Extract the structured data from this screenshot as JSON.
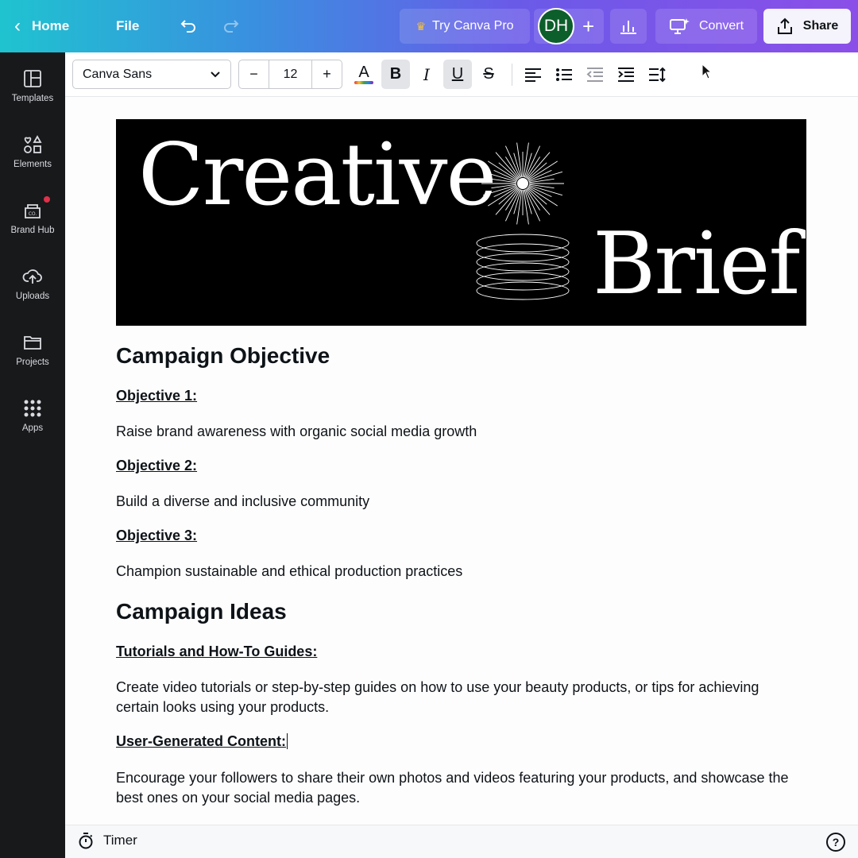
{
  "topbar": {
    "home_label": "Home",
    "file_label": "File",
    "try_pro_label": "Try Canva Pro",
    "avatar_initials": "DH",
    "convert_label": "Convert",
    "share_label": "Share"
  },
  "sidebar": {
    "items": [
      {
        "label": "Templates",
        "icon": "templates-icon"
      },
      {
        "label": "Elements",
        "icon": "elements-icon"
      },
      {
        "label": "Brand Hub",
        "icon": "brand-hub-icon"
      },
      {
        "label": "Uploads",
        "icon": "uploads-icon"
      },
      {
        "label": "Projects",
        "icon": "projects-icon"
      },
      {
        "label": "Apps",
        "icon": "apps-icon"
      }
    ]
  },
  "format_toolbar": {
    "font_family": "Canva Sans",
    "font_size": "12",
    "bold_active": true,
    "underline_active": true
  },
  "hero": {
    "word1": "Creative",
    "word2": "Brief"
  },
  "document": {
    "section1_title": "Campaign Objective",
    "objectives": [
      {
        "title": "Objective 1:",
        "text": "Raise brand awareness with organic social media growth"
      },
      {
        "title": "Objective 2:",
        "text": "Build a diverse and inclusive community"
      },
      {
        "title": "Objective 3:",
        "text": "Champion sustainable and ethical production practices"
      }
    ],
    "section2_title": "Campaign Ideas",
    "ideas": [
      {
        "title": "Tutorials and How-To Guides:",
        "text": "Create video tutorials or step-by-step guides on how to use your beauty products, or tips for achieving certain looks using your products."
      },
      {
        "title": "User-Generated Content:",
        "text": "Encourage your followers to share their own photos and videos featuring your products, and showcase the best ones on your social media pages."
      }
    ]
  },
  "bottombar": {
    "timer_label": "Timer",
    "help_label": "?"
  }
}
